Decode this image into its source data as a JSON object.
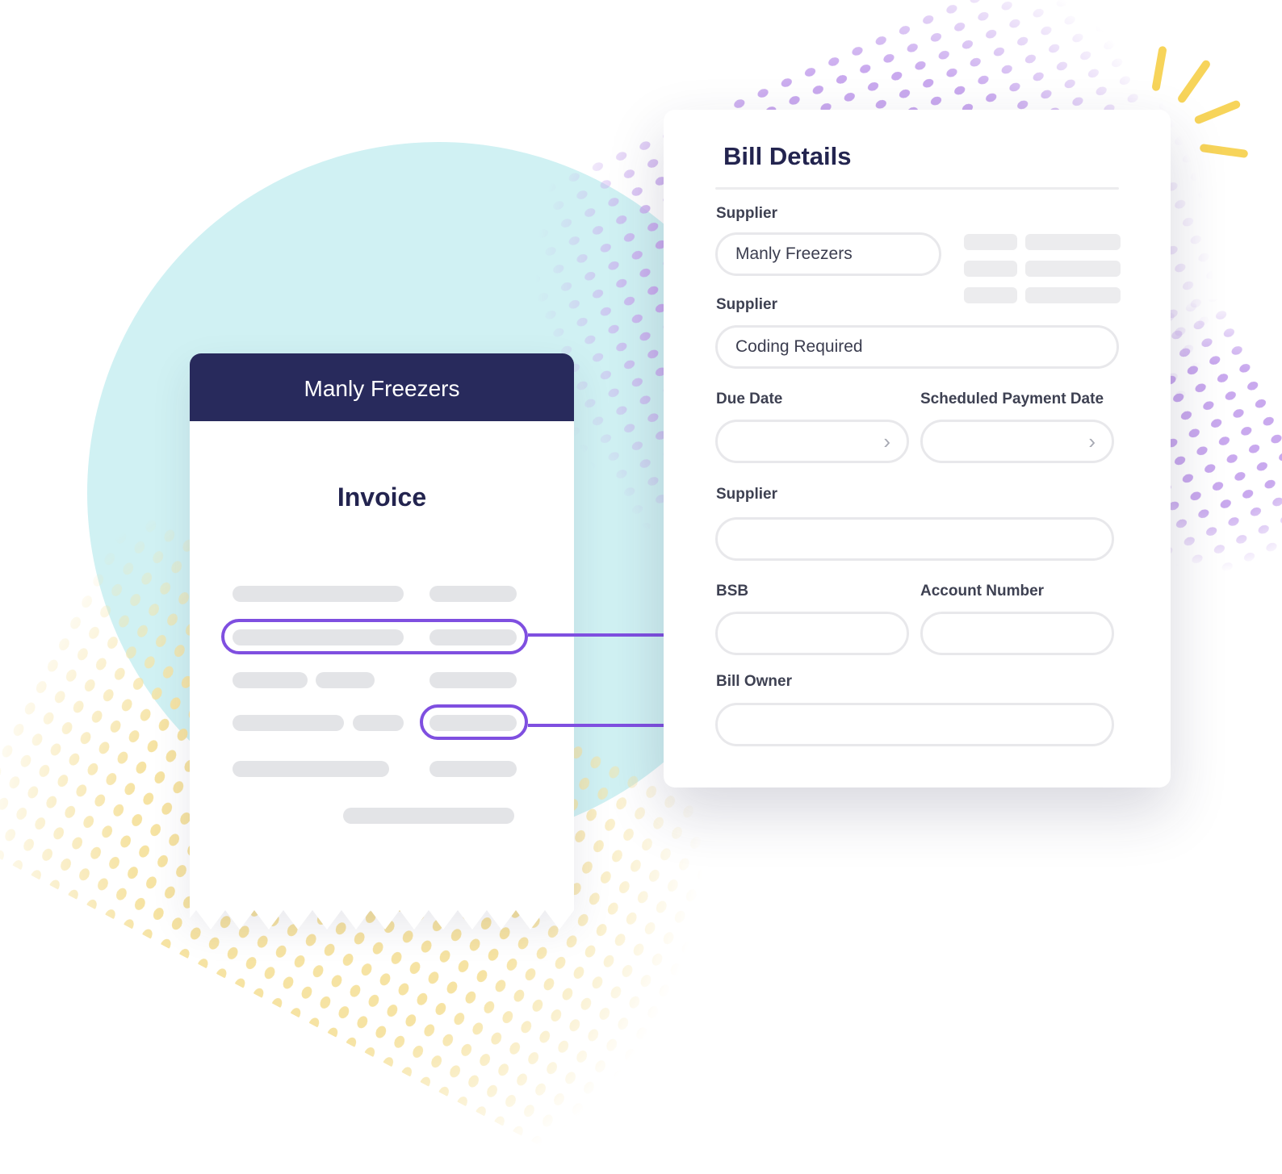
{
  "invoice": {
    "supplier_name": "Manly Freezers",
    "title": "Invoice"
  },
  "bill_details": {
    "title": "Bill Details",
    "supplier_label": "Supplier",
    "supplier_value": "Manly Freezers",
    "supplier_label_2": "Supplier",
    "status_value": "Coding Required",
    "due_date_label": "Due Date",
    "scheduled_payment_label": "Scheduled Payment Date",
    "supplier_label_3": "Supplier",
    "bsb_label": "BSB",
    "account_number_label": "Account Number",
    "bill_owner_label": "Bill Owner",
    "chevron_icon": "chevron-right-icon"
  },
  "colors": {
    "navy": "#282a5c",
    "highlight": "#7f4fe0",
    "circle": "#d0f1f3",
    "accent_yellow": "#f7d45a",
    "dot_purple": "#c9a9ee"
  }
}
